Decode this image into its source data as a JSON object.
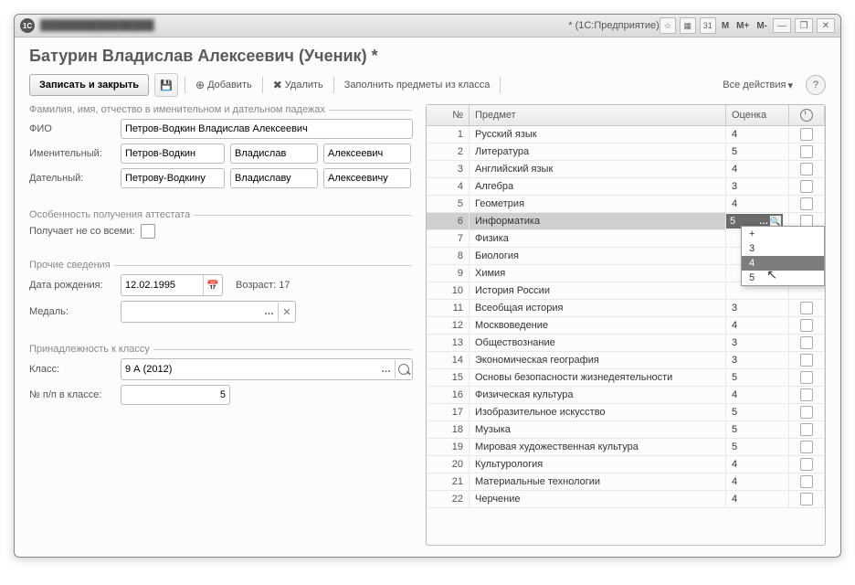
{
  "titlebar": {
    "suffix": "* (1С:Предприятие)",
    "m": "M",
    "mp": "M+",
    "mm": "M-"
  },
  "heading": "Батурин Владислав Алексеевич (Ученик) *",
  "toolbar": {
    "save_close": "Записать и закрыть",
    "add": "Добавить",
    "delete": "Удалить",
    "fill": "Заполнить предметы из класса",
    "all_actions": "Все действия"
  },
  "groups": {
    "names_legend": "Фамилия, имя, отчество в именительном и дательном падежах",
    "fio_label": "ФИО",
    "fio": "Петров-Водкин Владислав Алексеевич",
    "nom_label": "Именительный:",
    "nom1": "Петров-Водкин",
    "nom2": "Владислав",
    "nom3": "Алексеевич",
    "dat_label": "Дательный:",
    "dat1": "Петрову-Водкину",
    "dat2": "Владиславу",
    "dat3": "Алексеевичу",
    "att_legend": "Особенность получения аттестата",
    "not_all_label": "Получает не со всеми:",
    "other_legend": "Прочие сведения",
    "dob_label": "Дата рождения:",
    "dob": "12.02.1995",
    "age_label": "Возраст: 17",
    "medal_label": "Медаль:",
    "medal": "",
    "class_legend": "Принадлежность к классу",
    "class_label": "Класс:",
    "class": "9 А (2012)",
    "npp_label": "№ п/п в классе:",
    "npp": "5"
  },
  "table": {
    "h_n": "№",
    "h_subj": "Предмет",
    "h_grade": "Оценка",
    "rows": [
      {
        "n": "1",
        "s": "Русский язык",
        "g": "4",
        "c": true
      },
      {
        "n": "2",
        "s": "Литература",
        "g": "5",
        "c": true
      },
      {
        "n": "3",
        "s": "Английский язык",
        "g": "4",
        "c": true
      },
      {
        "n": "4",
        "s": "Алгебра",
        "g": "3",
        "c": true
      },
      {
        "n": "5",
        "s": "Геометрия",
        "g": "4",
        "c": true
      },
      {
        "n": "6",
        "s": "Информатика",
        "g": "5",
        "c": true,
        "sel": true,
        "edit": true
      },
      {
        "n": "7",
        "s": "Физика",
        "g": "+",
        "c": false,
        "dd": true
      },
      {
        "n": "8",
        "s": "Биология",
        "g": "3",
        "c": false,
        "dd": true
      },
      {
        "n": "9",
        "s": "Химия",
        "g": "4",
        "c": false,
        "dd": true,
        "hov": true
      },
      {
        "n": "10",
        "s": "История России",
        "g": "5",
        "c": false,
        "dd": true
      },
      {
        "n": "11",
        "s": "Всеобщая история",
        "g": "3",
        "c": true
      },
      {
        "n": "12",
        "s": "Москвоведение",
        "g": "4",
        "c": true
      },
      {
        "n": "13",
        "s": "Обществознание",
        "g": "3",
        "c": true
      },
      {
        "n": "14",
        "s": "Экономическая география",
        "g": "3",
        "c": true
      },
      {
        "n": "15",
        "s": "Основы безопасности жизнедеятельности",
        "g": "5",
        "c": true
      },
      {
        "n": "16",
        "s": "Физическая культура",
        "g": "4",
        "c": true
      },
      {
        "n": "17",
        "s": "Изобразительное искусство",
        "g": "5",
        "c": true
      },
      {
        "n": "18",
        "s": "Музыка",
        "g": "5",
        "c": true
      },
      {
        "n": "19",
        "s": "Мировая художественная культура",
        "g": "5",
        "c": true
      },
      {
        "n": "20",
        "s": "Культурология",
        "g": "4",
        "c": true
      },
      {
        "n": "21",
        "s": "Материальные технологии",
        "g": "4",
        "c": true
      },
      {
        "n": "22",
        "s": "Черчение",
        "g": "4",
        "c": true
      }
    ]
  }
}
